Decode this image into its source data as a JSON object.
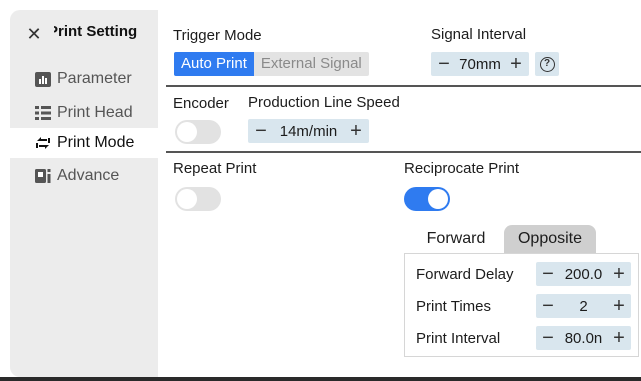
{
  "sidebar": {
    "title": "Print Setting",
    "items": [
      {
        "label": "Parameter",
        "icon": "bar-chart-icon"
      },
      {
        "label": "Print Head",
        "icon": "list-icon"
      },
      {
        "label": "Print Mode",
        "icon": "swap-icon"
      },
      {
        "label": "Advance",
        "icon": "settings-panel-icon"
      }
    ],
    "active_item": "Print Mode"
  },
  "main": {
    "trigger_mode": {
      "label": "Trigger Mode",
      "options": [
        "Auto Print",
        "External Signal"
      ],
      "selected": "Auto Print"
    },
    "signal_interval": {
      "label": "Signal Interval",
      "value": "70mm",
      "minus": "−",
      "plus": "+"
    },
    "encoder": {
      "label": "Encoder",
      "enabled": false
    },
    "production_line_speed": {
      "label": "Production Line Speed",
      "value": "14m/min",
      "minus": "−",
      "plus": "+"
    },
    "repeat_print": {
      "label": "Repeat Print",
      "enabled": false
    },
    "reciprocate_print": {
      "label": "Reciprocate Print",
      "enabled": true
    },
    "tabs": [
      "Forward",
      "Opposite"
    ],
    "active_tab": "Forward",
    "forward_settings": [
      {
        "label": "Forward Delay",
        "value": "200.0"
      },
      {
        "label": "Print Times",
        "value": "2"
      },
      {
        "label": "Print Interval",
        "value": "80.0n"
      }
    ],
    "stepper_minus": "−",
    "stepper_plus": "+"
  },
  "colors": {
    "accent": "#2f7bf0",
    "stepper_bg": "#d9e6ee",
    "sidebar_bg": "#ececec",
    "toggle_off": "#e2e2e2"
  }
}
